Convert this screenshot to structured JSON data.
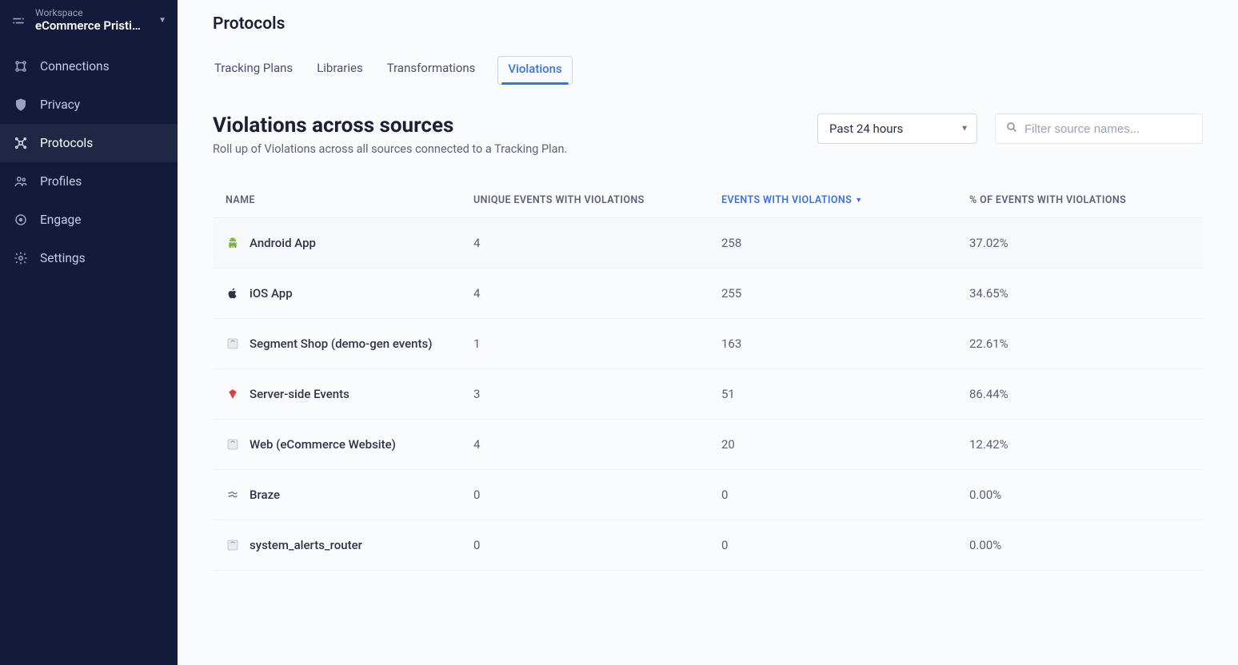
{
  "workspace": {
    "label": "Workspace",
    "name": "eCommerce Pristi…"
  },
  "sidebar": {
    "items": [
      {
        "label": "Connections",
        "icon": "connections-icon"
      },
      {
        "label": "Privacy",
        "icon": "shield-icon"
      },
      {
        "label": "Protocols",
        "icon": "protocols-icon"
      },
      {
        "label": "Profiles",
        "icon": "profiles-icon"
      },
      {
        "label": "Engage",
        "icon": "engage-icon"
      },
      {
        "label": "Settings",
        "icon": "gear-icon"
      }
    ],
    "active_index": 2
  },
  "header": {
    "title": "Protocols",
    "tabs": [
      "Tracking Plans",
      "Libraries",
      "Transformations",
      "Violations"
    ],
    "active_tab_index": 3
  },
  "section": {
    "title": "Violations across sources",
    "subtitle": "Roll up of Violations across all sources connected to a Tracking Plan."
  },
  "controls": {
    "time_range_selected": "Past 24 hours",
    "search_placeholder": "Filter source names..."
  },
  "table": {
    "columns": {
      "name": "NAME",
      "unique": "UNIQUE EVENTS WITH VIOLATIONS",
      "events": "EVENTS WITH VIOLATIONS",
      "pct": "% OF EVENTS WITH VIOLATIONS"
    },
    "sort_column": "events",
    "rows": [
      {
        "icon": "android",
        "name": "Android App",
        "unique": "4",
        "events": "258",
        "pct": "37.02%"
      },
      {
        "icon": "apple",
        "name": "iOS App",
        "unique": "4",
        "events": "255",
        "pct": "34.65%"
      },
      {
        "icon": "js",
        "name": "Segment Shop (demo-gen events)",
        "unique": "1",
        "events": "163",
        "pct": "22.61%"
      },
      {
        "icon": "ruby",
        "name": "Server-side Events",
        "unique": "3",
        "events": "51",
        "pct": "86.44%"
      },
      {
        "icon": "js",
        "name": "Web (eCommerce Website)",
        "unique": "4",
        "events": "20",
        "pct": "12.42%"
      },
      {
        "icon": "braze",
        "name": "Braze",
        "unique": "0",
        "events": "0",
        "pct": "0.00%"
      },
      {
        "icon": "js",
        "name": "system_alerts_router",
        "unique": "0",
        "events": "0",
        "pct": "0.00%"
      }
    ]
  }
}
